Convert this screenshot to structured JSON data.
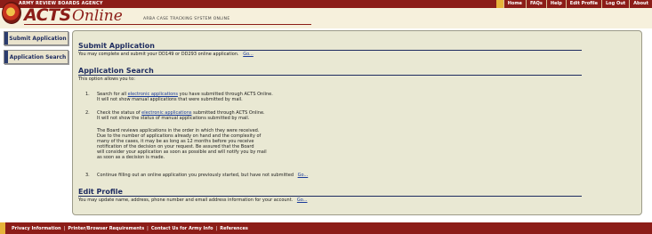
{
  "header": {
    "agency": "ARMY REVIEW BOARDS AGENCY",
    "logo_acts": "ACTS",
    "logo_online": "Online",
    "subtitle": "ARBA CASE TRACKING SYSTEM ONLINE"
  },
  "topnav": [
    "Home",
    "FAQs",
    "Help",
    "Edit Profile",
    "Log Out",
    "About"
  ],
  "sidebar": {
    "items": [
      {
        "label": "Submit Application"
      },
      {
        "label": "Application Search"
      }
    ]
  },
  "submit": {
    "title": "Submit Application",
    "text": "You may complete and submit your DD149 or DD293 online application.",
    "go": "Go..."
  },
  "search": {
    "title": "Application Search",
    "intro": "This option allows you to:",
    "item1_num": "1.",
    "item1_pre": "Search for all",
    "item1_link": "electronic applications",
    "item1_post": "you have submitted through ACTS Online.",
    "item1_line2": "It will not show manual applications that were submitted by mail.",
    "item2_num": "2.",
    "item2_pre": "Check the status of",
    "item2_link": "electronic applications",
    "item2_post": "submitted through ACTS Online.",
    "item2_line2": "It will not show the status of manual applications submitted by mail.",
    "para": [
      "The Board reviews applications in the order in which they were received.",
      "Due to the number of applications already on hand and the complexity of",
      "many of the cases, it may be as long as 12 months before you receive",
      "notification of the decision on your request. Be assured that the Board",
      "will consider your application as soon as possible and will notify you by mail",
      "as soon as a decision is made."
    ],
    "item3_num": "3.",
    "item3_text": "Continue filling out an online application you previously started, but have not submitted",
    "item3_go": "Go..."
  },
  "profile": {
    "title": "Edit Profile",
    "text": "You may update name, address, phone number and email address information for your account.",
    "go": "Go..."
  },
  "footer": {
    "links": [
      "Privacy Information",
      "Printer/Browser Requirements",
      "Contact Us for Army Info",
      "References"
    ]
  },
  "colors": {
    "brand": "#8c1d18",
    "accent": "#e6b43a",
    "navy": "#1d2b5f",
    "panel": "#e9e8d3"
  }
}
